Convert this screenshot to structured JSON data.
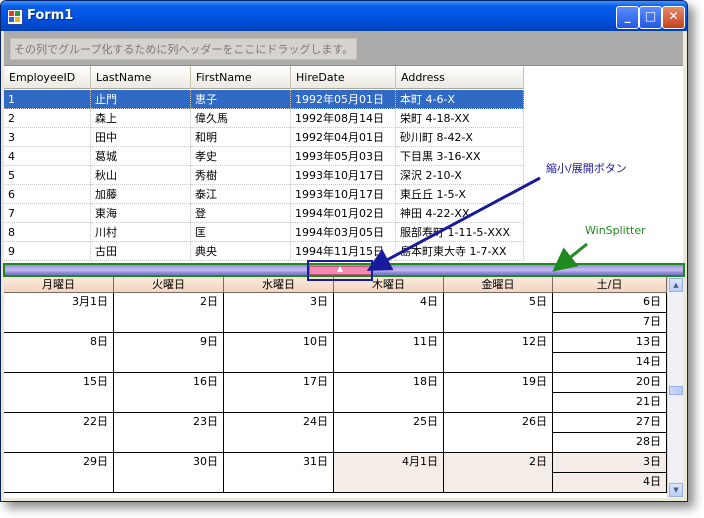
{
  "window": {
    "title": "Form1",
    "minimize": "_",
    "maximize": "□",
    "close": "✕"
  },
  "group_area": {
    "hint": "その列でグループ化するために列ヘッダーをここにドラッグします。"
  },
  "grid": {
    "columns": [
      "EmployeeID",
      "LastName",
      "FirstName",
      "HireDate",
      "Address"
    ],
    "rows": [
      [
        "1",
        "止門",
        "恵子",
        "1992年05月01日",
        "本町 4-6-X"
      ],
      [
        "2",
        "森上",
        "偉久馬",
        "1992年08月14日",
        "栄町 4-18-XX"
      ],
      [
        "3",
        "田中",
        "和明",
        "1992年04月01日",
        "砂川町 8-42-X"
      ],
      [
        "4",
        "葛城",
        "孝史",
        "1993年05月03日",
        "下目黒 3-16-XX"
      ],
      [
        "5",
        "秋山",
        "秀樹",
        "1993年10月17日",
        "深沢 2-10-X"
      ],
      [
        "6",
        "加藤",
        "泰江",
        "1993年10月17日",
        "東丘丘 1-5-X"
      ],
      [
        "7",
        "東海",
        "登",
        "1994年01月02日",
        "神田 4-22-XX"
      ],
      [
        "8",
        "川村",
        "匡",
        "1994年03月05日",
        "服部寿町 1-11-5-XXX"
      ],
      [
        "9",
        "古田",
        "典央",
        "1994年11月15日",
        "島本町東大寺 1-7-XX"
      ]
    ],
    "selected_row": 0
  },
  "splitter": {
    "button_glyph": "▲"
  },
  "calendar": {
    "headers": [
      "月曜日",
      "火曜日",
      "水曜日",
      "木曜日",
      "金曜日",
      "土/日"
    ],
    "weeks": [
      {
        "days": [
          "3月1日",
          "2日",
          "3日",
          "4日",
          "5日"
        ],
        "sat": "6日",
        "sun": "7日"
      },
      {
        "days": [
          "8日",
          "9日",
          "10日",
          "11日",
          "12日"
        ],
        "sat": "13日",
        "sun": "14日"
      },
      {
        "days": [
          "15日",
          "16日",
          "17日",
          "18日",
          "19日"
        ],
        "sat": "20日",
        "sun": "21日"
      },
      {
        "days": [
          "22日",
          "23日",
          "24日",
          "25日",
          "26日"
        ],
        "sat": "27日",
        "sun": "28日"
      },
      {
        "days": [
          "29日",
          "30日",
          "31日",
          "4月1日",
          "2日"
        ],
        "sat": "3日",
        "sun": "4日"
      }
    ],
    "other_month_cells": [
      "4-3",
      "4-4",
      "4-sat",
      "4-sun"
    ]
  },
  "annotations": {
    "toggle_label": "縮小/展開ボタン",
    "splitter_label": "WinSplitter",
    "toggle_color": "#1a1a9c",
    "splitter_color": "#1f8a1f"
  }
}
